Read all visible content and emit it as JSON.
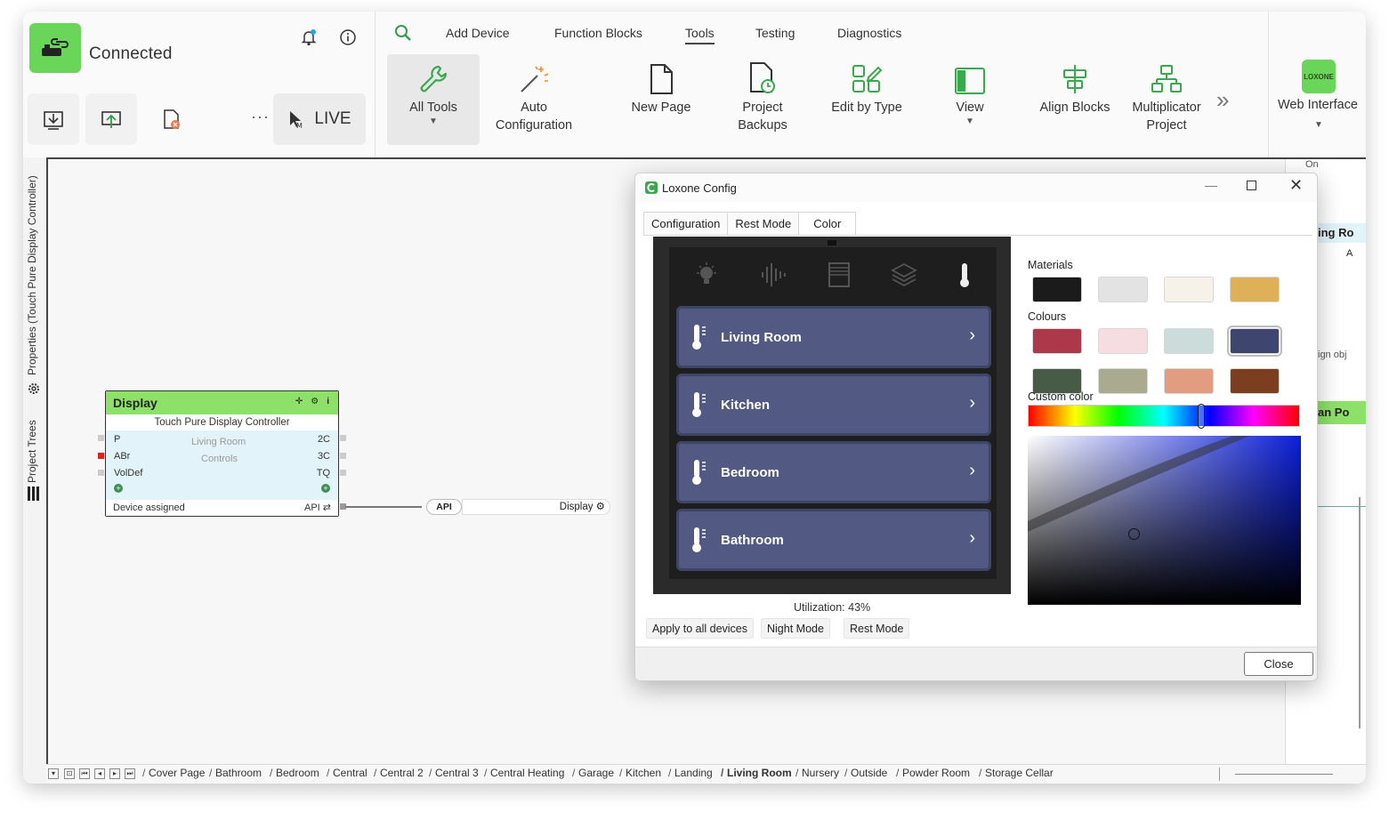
{
  "status": {
    "title": "Connected"
  },
  "toolbar": {
    "live_label": "LIVE",
    "more": "···"
  },
  "ribbon": {
    "tabs": [
      "Add Device",
      "Function Blocks",
      "Tools",
      "Testing",
      "Diagnostics"
    ],
    "active_tab": "Tools",
    "tools": [
      {
        "label": "All Tools",
        "icon": "wrench-icon"
      },
      {
        "label": "Auto Configuration",
        "icon": "magic-wand-icon"
      },
      {
        "label": "New Page",
        "icon": "page-icon"
      },
      {
        "label": "Project Backups",
        "icon": "backup-clock-icon"
      },
      {
        "label": "Edit by Type",
        "icon": "edit-type-icon"
      },
      {
        "label": "View",
        "icon": "view-panel-icon"
      },
      {
        "label": "Align Blocks",
        "icon": "align-icon"
      },
      {
        "label": "Multiplicator Project",
        "icon": "multiplicator-icon"
      }
    ],
    "tool_lines": {
      "all_tools": "All Tools",
      "auto_1": "Auto",
      "auto_2": "Configuration",
      "new_page": "New Page",
      "backups_1": "Project",
      "backups_2": "Backups",
      "edit_type": "Edit by Type",
      "view": "View",
      "align": "Align Blocks",
      "multi_1": "Multiplicator",
      "multi_2": "Project"
    }
  },
  "web_interface": {
    "label": "Web Interface",
    "badge": "LOXONE"
  },
  "sidebar": {
    "properties": "Properties (Touch Pure Display Controller)",
    "project_trees": "Project Trees"
  },
  "block": {
    "title": "Display",
    "subtitle": "Touch Pure Display Controller",
    "left_ports": [
      "P",
      "ABr",
      "VolDef"
    ],
    "right_ports": [
      "2C",
      "3C",
      "TQ"
    ],
    "center_1": "Living Room",
    "center_2": "Controls",
    "footer_left": "Device assigned",
    "footer_right": "API ⇄"
  },
  "connection": {
    "api_label": "API",
    "target": "Display ⚙"
  },
  "behind_window": {
    "frag1": "On",
    "frag2": "ing Ro",
    "frag3": "A",
    "frag4": "ign obj",
    "frag5": "an Po"
  },
  "dialog": {
    "title": "Loxone Config",
    "tabs": [
      "Configuration",
      "Rest Mode",
      "Color"
    ],
    "rooms": [
      "Living Room",
      "Kitchen",
      "Bedroom",
      "Bathroom"
    ],
    "utilization": "Utilization: 43%",
    "buttons": {
      "apply_all": "Apply to all devices",
      "night": "Night Mode",
      "rest": "Rest Mode",
      "close": "Close"
    },
    "materials_label": "Materials",
    "colours_label": "Colours",
    "custom_label": "Custom color",
    "materials": [
      "#1b1b1b",
      "#e3e3e3",
      "#f6f2ea",
      "#deb158"
    ],
    "colours": [
      "#ad3849",
      "#f6dde2",
      "#cbdcda",
      "#3e4670",
      "#475b47",
      "#a9aa90",
      "#e29d80",
      "#7b3e1e"
    ],
    "selected_colour": "#3e4670"
  },
  "pages": [
    "Cover Page",
    "Bathroom",
    "Bedroom",
    "Central",
    "Central 2",
    "Central 3",
    "Central Heating",
    "Garage",
    "Kitchen",
    "Landing",
    "Living Room",
    "Nursery",
    "Outside",
    "Powder Room",
    "Storage Cellar"
  ],
  "active_page": "Living Room"
}
